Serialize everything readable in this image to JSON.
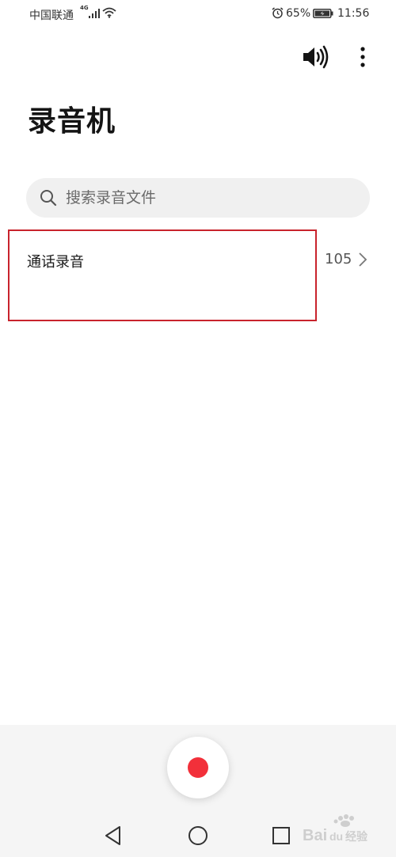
{
  "status_bar": {
    "carrier": "中国联通",
    "network": "4G",
    "battery": "65%",
    "time": "11:56"
  },
  "header": {
    "title": "录音机",
    "speaker_icon": "speaker-icon",
    "more_icon": "more-vert-icon"
  },
  "search": {
    "placeholder": "搜索录音文件"
  },
  "list": {
    "items": [
      {
        "title": "通话录音",
        "count": "105"
      }
    ]
  },
  "colors": {
    "record_red": "#f2303a",
    "highlight_red": "#c8232c",
    "search_bg": "#f0f0f0",
    "bottom_bg": "#f5f5f5"
  },
  "watermark": {
    "text": "Baidu经验"
  }
}
